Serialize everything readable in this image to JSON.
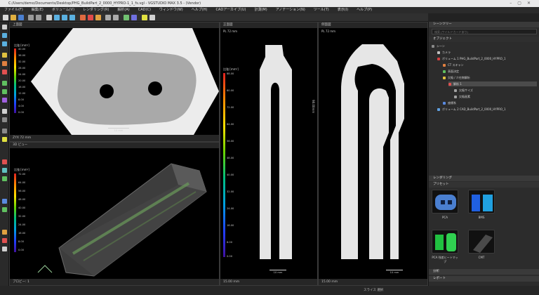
{
  "window": {
    "title": "C:/Users/demo/Documents/Desktop/PHG_BuildPart_2_0000_HYPRO-1_1_fs.vgl - VGSTUDIO MAX 3.5 - (Vendor)"
  },
  "menu": {
    "items": [
      "ファイル(F)",
      "編集(E)",
      "ボリューム(V)",
      "レンダリング(R)",
      "解析(A)",
      "CAD(C)",
      "ウィンドウ(W)",
      "ヘルプ(H)",
      "CADアーカイブ(U)",
      "計測(M)",
      "アノテーション(N)",
      "ツール(T)",
      "表示(I)",
      "ヘルプ(P)"
    ]
  },
  "panels": {
    "top_left": {
      "title": "上面図",
      "legend_title": "比強 [mm²]",
      "ticks": [
        "40.00",
        "36.00",
        "32.00",
        "28.00",
        "24.00",
        "20.00",
        "16.00",
        "12.00",
        "8.00",
        "4.00",
        "0.00"
      ],
      "scale": "10 mm",
      "footer": "ZYX 72 mm"
    },
    "bottom_left": {
      "title": "3D ビュー",
      "legend_title": "比強 [mm²]",
      "ticks": [
        "72.00",
        "64.00",
        "56.00",
        "48.00",
        "40.00",
        "32.00",
        "24.00",
        "16.00",
        "8.00",
        "0.00"
      ],
      "footer": "プロビー: 1"
    },
    "middle": {
      "title": "正面図",
      "sub": "PL 72 mm",
      "legend_title": "比強 [mm²]",
      "ticks": [
        "88.00",
        "80.00",
        "72.00",
        "64.00",
        "56.00",
        "48.00",
        "40.00",
        "32.00",
        "24.00",
        "16.00",
        "8.00",
        "0.00"
      ],
      "scale": "10 mm",
      "footer": "15.00 mm"
    },
    "right": {
      "title": "側面図",
      "sub": "PL 72 mm",
      "scale": "10 mm",
      "footer": "15.00 mm"
    }
  },
  "sidebar": {
    "scene_header": "シーンツリー",
    "search_placeholder": "検索 (ワイルドカードあり)",
    "objects_header": "オブジェクト",
    "tree": [
      "シーン",
      "カメラ",
      "ボリューム 1 PHG_BuildPart_2_0000_HYPRO_1",
      "CT スキャン",
      "表面決定",
      "欠陥 / 介在物解析",
      "解析 1",
      "欠陥サイズ",
      "欠陥画素",
      "座標系",
      "ボリューム 2 CAD_BuildPart_2_0000_HYPRO_1"
    ],
    "render_header": "レンダリング",
    "presets_header": "プリセット",
    "presets": [
      "PCA",
      "BMS",
      "PCA 残差ヒートマップ",
      "CMT"
    ],
    "bottom_items": [
      "分析",
      "レポート"
    ]
  },
  "status": {
    "text": "スライス 選択"
  }
}
